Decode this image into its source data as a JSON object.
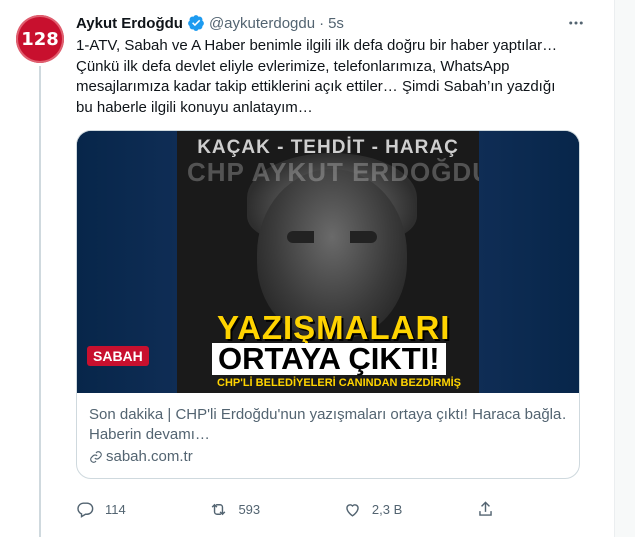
{
  "tweet": {
    "avatar_text": "128",
    "name": "Aykut Erdoğdu",
    "handle": "@aykuterdogdu",
    "separator": "·",
    "time": "5s",
    "text": "1-ATV, Sabah ve A Haber benimle ilgili ilk defa doğru bir haber yaptılar… Çünkü ilk defa devlet eliyle evlerimize, telefonlarımıza, WhatsApp mesajlarımıza kadar takip ettiklerini açık ettiler… Şimdi Sabah’ın yazdığı bu haberle ilgili konuyu anlatayım…",
    "card": {
      "image_texts": {
        "top": "KAÇAK - TEHDİT - HARAÇ",
        "ghost": "CHP AYKUT ERDOĞDU",
        "banner1": "YAZIŞMALARI",
        "banner2": "ORTAYA ÇIKTI!",
        "subbanner": "CHP'Lİ BELEDİYELERİ CANINDAN BEZDİRMİŞ",
        "logo": "SABAH"
      },
      "title": "Son dakika | CHP'li Erdoğdu'nun yazışmaları ortaya çıktı! Haraca bağla…",
      "description": "Haberin devamı…",
      "domain": "sabah.com.tr"
    },
    "actions": {
      "reply_count": "114",
      "retweet_count": "593",
      "like_count": "2,3 B"
    }
  },
  "colors": {
    "verified": "#1d9bf0",
    "muted": "#536471",
    "avatar_bg": "#c8102e"
  }
}
